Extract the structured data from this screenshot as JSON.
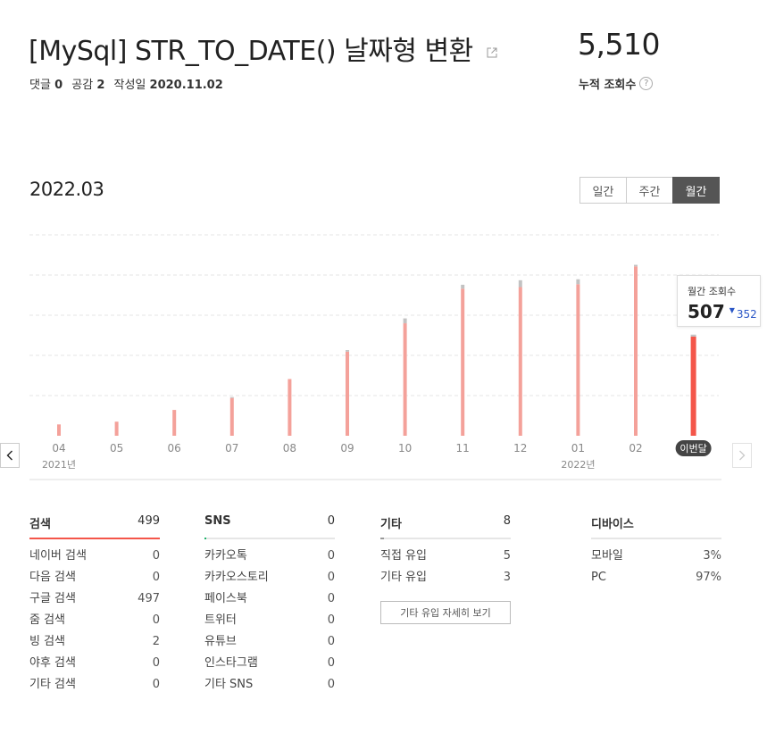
{
  "post": {
    "title": "[MySql] STR_TO_DATE() 날짜형 변환",
    "comments_label": "댓글",
    "comments": "0",
    "likes_label": "공감",
    "likes": "2",
    "date_label": "작성일",
    "date": "2020.11.02"
  },
  "stats": {
    "total_views": "5,510",
    "total_label": "누적 조회수",
    "help": "?"
  },
  "period": {
    "title": "2022.03",
    "tabs": [
      {
        "label": "일간",
        "active": false
      },
      {
        "label": "주간",
        "active": false
      },
      {
        "label": "월간",
        "active": true
      }
    ]
  },
  "tooltip": {
    "label": "월간 조회수",
    "value": "507",
    "prev": "352"
  },
  "chart_data": {
    "type": "bar",
    "categories": [
      "04",
      "05",
      "06",
      "07",
      "08",
      "09",
      "10",
      "11",
      "12",
      "01",
      "02",
      "이번달"
    ],
    "year_labels": [
      {
        "index": 0,
        "label": "2021년"
      },
      {
        "index": 9,
        "label": "2022년"
      }
    ],
    "series": [
      {
        "values": [
          58,
          72,
          132,
          193,
          290,
          430,
          575,
          752,
          760,
          775,
          866,
          507
        ]
      }
    ],
    "overlay_values": [
      0,
      0,
      0,
      5,
      0,
      8,
      25,
      20,
      35,
      25,
      8,
      10
    ],
    "ylim": [
      0,
      1050
    ],
    "grid": true,
    "colors": {
      "bar": "#f4a19a",
      "current": "#f4564a",
      "overlay": "#c2c2c2"
    }
  },
  "sources": {
    "search": {
      "title": "검색",
      "count": "499",
      "color": "#f4564a",
      "fill": 1.0,
      "items": [
        {
          "label": "네이버 검색",
          "value": "0"
        },
        {
          "label": "다음 검색",
          "value": "0"
        },
        {
          "label": "구글 검색",
          "value": "497"
        },
        {
          "label": "줌 검색",
          "value": "0"
        },
        {
          "label": "빙 검색",
          "value": "2"
        },
        {
          "label": "야후 검색",
          "value": "0"
        },
        {
          "label": "기타 검색",
          "value": "0"
        }
      ]
    },
    "sns": {
      "title": "SNS",
      "count": "0",
      "color": "#1fb36b",
      "fill": 0.01,
      "items": [
        {
          "label": "카카오톡",
          "value": "0"
        },
        {
          "label": "카카오스토리",
          "value": "0"
        },
        {
          "label": "페이스북",
          "value": "0"
        },
        {
          "label": "트위터",
          "value": "0"
        },
        {
          "label": "유튜브",
          "value": "0"
        },
        {
          "label": "인스타그램",
          "value": "0"
        },
        {
          "label": "기타 SNS",
          "value": "0"
        }
      ]
    },
    "etc": {
      "title": "기타",
      "count": "8",
      "color": "#999999",
      "fill": 0.03,
      "items": [
        {
          "label": "직접 유입",
          "value": "5"
        },
        {
          "label": "기타 유입",
          "value": "3"
        }
      ],
      "detail_button": "기타 유입 자세히 보기"
    },
    "device": {
      "title": "디바이스",
      "items": [
        {
          "label": "모바일",
          "value": "3%"
        },
        {
          "label": "PC",
          "value": "97%"
        }
      ]
    }
  }
}
